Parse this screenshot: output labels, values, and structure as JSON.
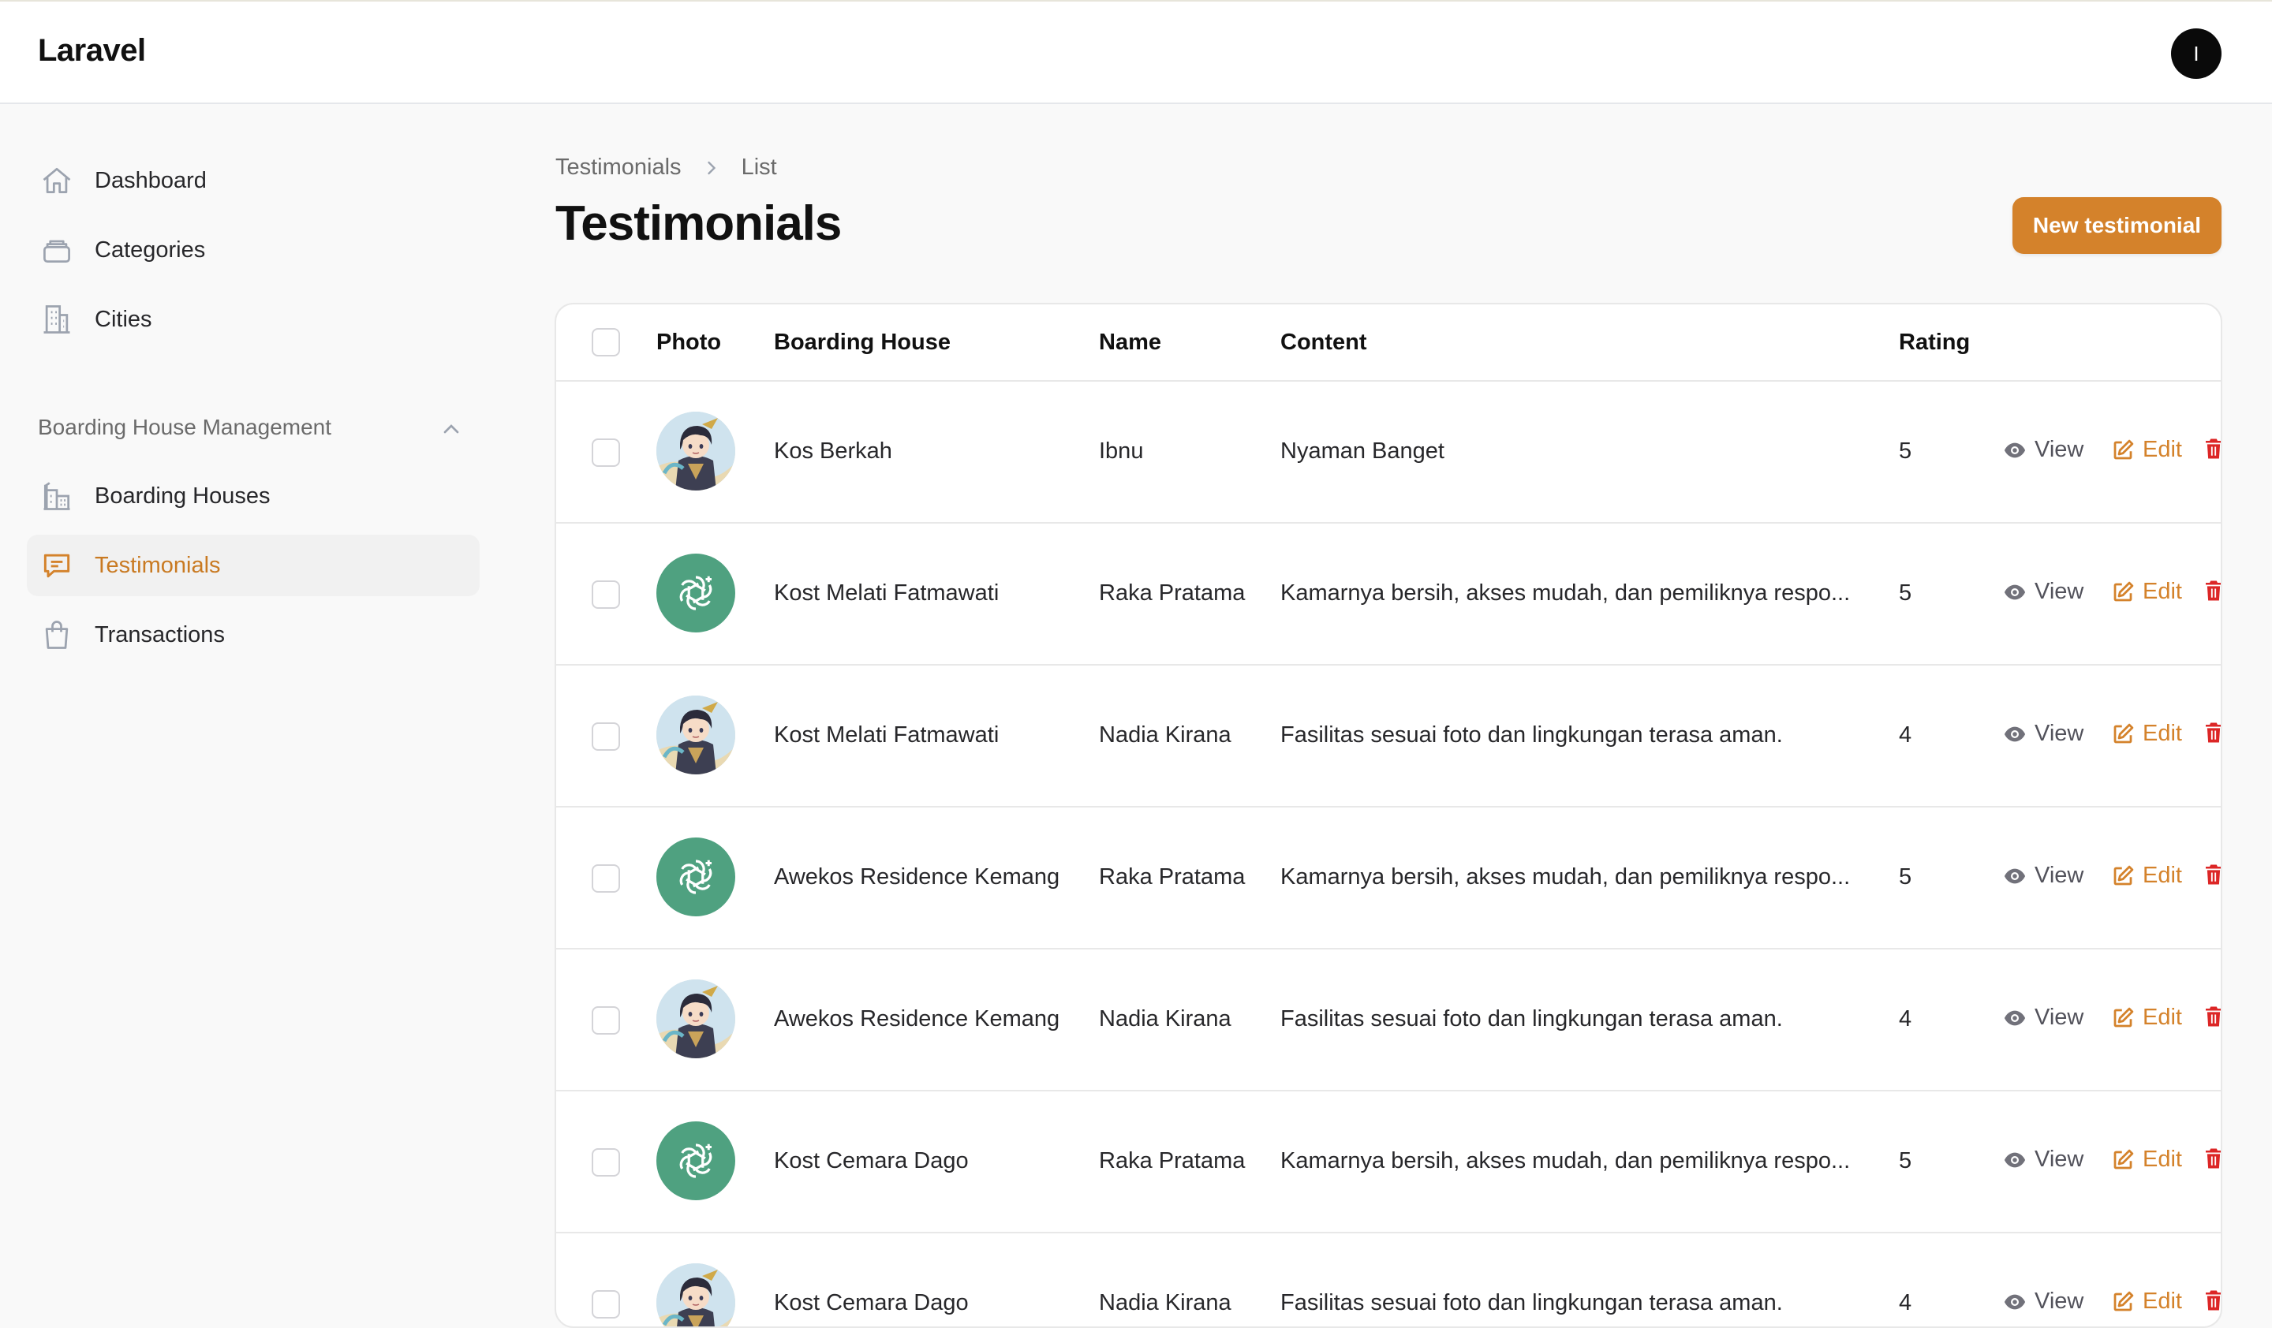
{
  "app": {
    "brand": "Laravel",
    "user_initial": "I"
  },
  "sidebar": {
    "items": [
      {
        "label": "Dashboard",
        "icon": "home-icon"
      },
      {
        "label": "Categories",
        "icon": "stack-icon"
      },
      {
        "label": "Cities",
        "icon": "building-icon"
      }
    ],
    "group": {
      "label": "Boarding House Management",
      "items": [
        {
          "label": "Boarding Houses",
          "icon": "building-office-icon"
        },
        {
          "label": "Testimonials",
          "icon": "chat-icon",
          "active": true
        },
        {
          "label": "Transactions",
          "icon": "shopping-bag-icon"
        }
      ]
    }
  },
  "breadcrumb": {
    "parent": "Testimonials",
    "current": "List"
  },
  "page": {
    "title": "Testimonials",
    "new_button": "New testimonial"
  },
  "table": {
    "headers": {
      "photo": "Photo",
      "boarding_house": "Boarding House",
      "name": "Name",
      "content": "Content",
      "rating": "Rating"
    },
    "actions": {
      "view": "View",
      "edit": "Edit"
    },
    "rows": [
      {
        "photo": "anime",
        "boarding_house": "Kos Berkah",
        "name": "Ibnu",
        "content": "Nyaman Banget",
        "rating": "5"
      },
      {
        "photo": "gpt",
        "boarding_house": "Kost Melati Fatmawati",
        "name": "Raka Pratama",
        "content": "Kamarnya bersih, akses mudah, dan pemiliknya respo...",
        "rating": "5"
      },
      {
        "photo": "anime",
        "boarding_house": "Kost Melati Fatmawati",
        "name": "Nadia Kirana",
        "content": "Fasilitas sesuai foto dan lingkungan terasa aman.",
        "rating": "4"
      },
      {
        "photo": "gpt",
        "boarding_house": "Awekos Residence Kemang",
        "name": "Raka Pratama",
        "content": "Kamarnya bersih, akses mudah, dan pemiliknya respo...",
        "rating": "5"
      },
      {
        "photo": "anime",
        "boarding_house": "Awekos Residence Kemang",
        "name": "Nadia Kirana",
        "content": "Fasilitas sesuai foto dan lingkungan terasa aman.",
        "rating": "4"
      },
      {
        "photo": "gpt",
        "boarding_house": "Kost Cemara Dago",
        "name": "Raka Pratama",
        "content": "Kamarnya bersih, akses mudah, dan pemiliknya respo...",
        "rating": "5"
      },
      {
        "photo": "anime",
        "boarding_house": "Kost Cemara Dago",
        "name": "Nadia Kirana",
        "content": "Fasilitas sesuai foto dan lingkungan terasa aman.",
        "rating": "4"
      }
    ]
  },
  "colors": {
    "accent": "#d4822b",
    "danger": "#dc2626",
    "avatar_green": "#4fa180"
  }
}
